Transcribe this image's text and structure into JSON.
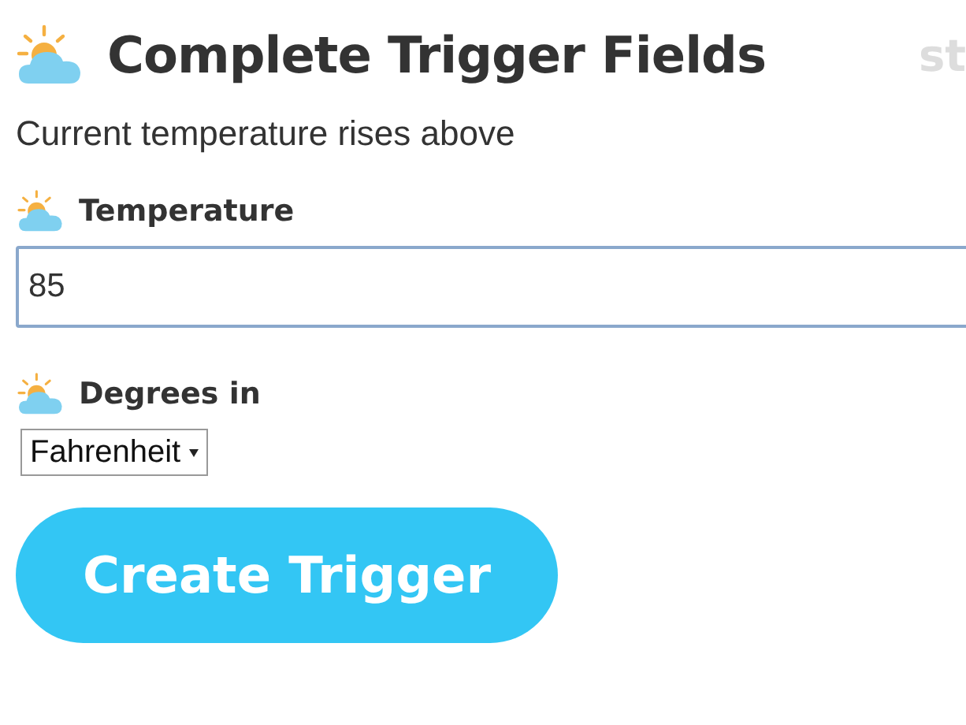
{
  "header": {
    "title": "Complete Trigger Fields",
    "step_label": "st"
  },
  "description": "Current temperature rises above",
  "fields": [
    {
      "kind": "text",
      "label": "Temperature",
      "value": "85"
    },
    {
      "kind": "select",
      "label": "Degrees in",
      "value": "Fahrenheit"
    }
  ],
  "submit_button": "Create Trigger"
}
